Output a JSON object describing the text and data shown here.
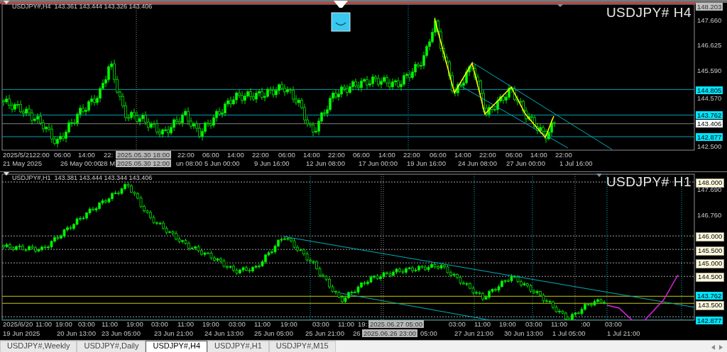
{
  "top_chart": {
    "header": "USDJPY#,H4  143.361 143.444 143.326 143.406",
    "symbol_title": "USDJPY# H4",
    "price_labels": [
      {
        "text": "148.203",
        "kind": "gray"
      },
      {
        "text": "147.660",
        "kind": "plain"
      },
      {
        "text": "146.625",
        "kind": "plain"
      },
      {
        "text": "145.590",
        "kind": "plain"
      },
      {
        "text": "144.805",
        "kind": "cyan"
      },
      {
        "text": "144.570",
        "kind": "plain"
      },
      {
        "text": "143.762",
        "kind": "cyan"
      },
      {
        "text": "143.406",
        "kind": "white"
      },
      {
        "text": "142.877",
        "kind": "cyan"
      },
      {
        "text": "142.500",
        "kind": "plain"
      }
    ],
    "time_row_1": [
      {
        "text": "2025/5/21",
        "kind": "plain"
      },
      {
        "text": "22:00",
        "kind": "plain"
      },
      {
        "text": "06:00",
        "kind": "plain"
      },
      {
        "text": "14:00",
        "kind": "plain"
      },
      {
        "text": "22:",
        "kind": "plain"
      },
      {
        "text": "2025.05.30 18:00",
        "kind": "cursor"
      },
      {
        "text": "22:00",
        "kind": "plain"
      },
      {
        "text": "06:00",
        "kind": "plain"
      },
      {
        "text": "14:00",
        "kind": "plain"
      },
      {
        "text": "22:00",
        "kind": "plain"
      },
      {
        "text": "06:00",
        "kind": "plain"
      },
      {
        "text": "14:00",
        "kind": "plain"
      },
      {
        "text": "22:00",
        "kind": "plain"
      },
      {
        "text": "06:00",
        "kind": "plain"
      },
      {
        "text": "14:00",
        "kind": "plain"
      },
      {
        "text": "22:00",
        "kind": "plain"
      },
      {
        "text": "06:00",
        "kind": "plain"
      },
      {
        "text": "14:00",
        "kind": "plain"
      },
      {
        "text": "22:00",
        "kind": "plain"
      },
      {
        "text": "06:00",
        "kind": "plain"
      },
      {
        "text": "14:00",
        "kind": "plain"
      },
      {
        "text": "22:00",
        "kind": "plain"
      }
    ],
    "time_row_2": [
      {
        "text": "21 May 2025",
        "kind": "plain"
      },
      {
        "text": "26 May 00:00",
        "kind": "plain"
      },
      {
        "text": "28 M",
        "kind": "plain"
      },
      {
        "text": "2025.05.30 12:00",
        "kind": "cursor"
      },
      {
        "text": "un 08:00",
        "kind": "plain"
      },
      {
        "text": "5 Jun 00:00",
        "kind": "plain"
      },
      {
        "text": "9 Jun 16:00",
        "kind": "plain"
      },
      {
        "text": "12 Jun 08:00",
        "kind": "plain"
      },
      {
        "text": "17 Jun 00:00",
        "kind": "plain"
      },
      {
        "text": "19 Jun 16:00",
        "kind": "plain"
      },
      {
        "text": "24 Jun 08:00",
        "kind": "plain"
      },
      {
        "text": "27 Jun 00:00",
        "kind": "plain"
      },
      {
        "text": "1 Jul 16:00",
        "kind": "plain"
      }
    ]
  },
  "bottom_chart": {
    "header": "USDJPY#,H1  143.381 143.444 143.344 143.406",
    "symbol_title": "USDJPY# H1",
    "price_labels": [
      {
        "text": "148.000",
        "kind": "cream"
      },
      {
        "text": "147.690",
        "kind": "plain"
      },
      {
        "text": "146.760",
        "kind": "plain"
      },
      {
        "text": "146.000",
        "kind": "cream"
      },
      {
        "text": "145.500",
        "kind": "cream"
      },
      {
        "text": "145.000",
        "kind": "cream"
      },
      {
        "text": "144.500",
        "kind": "cream"
      },
      {
        "text": "143.762",
        "kind": "cyan"
      },
      {
        "text": "143.500",
        "kind": "cream"
      },
      {
        "text": "142.877",
        "kind": "cyan"
      }
    ],
    "time_row_1": [
      {
        "text": "2025/6/20",
        "kind": "plain"
      },
      {
        "text": "11:00",
        "kind": "plain"
      },
      {
        "text": "19:00",
        "kind": "plain"
      },
      {
        "text": "03:00",
        "kind": "plain"
      },
      {
        "text": "11:00",
        "kind": "plain"
      },
      {
        "text": "19:00",
        "kind": "plain"
      },
      {
        "text": "03:00",
        "kind": "plain"
      },
      {
        "text": "11:00",
        "kind": "plain"
      },
      {
        "text": "19:00",
        "kind": "plain"
      },
      {
        "text": "03:00",
        "kind": "plain"
      },
      {
        "text": "11:00",
        "kind": "plain"
      },
      {
        "text": "19:00",
        "kind": "plain"
      },
      {
        "text": "03:00",
        "kind": "plain"
      },
      {
        "text": "11:00",
        "kind": "plain"
      },
      {
        "text": "19:",
        "kind": "plain"
      },
      {
        "text": "2025.06.27 05:00",
        "kind": "cursor"
      },
      {
        "text": "03:00",
        "kind": "plain"
      },
      {
        "text": "11:00",
        "kind": "plain"
      },
      {
        "text": "19:00",
        "kind": "plain"
      },
      {
        "text": "03:00",
        "kind": "plain"
      },
      {
        "text": "11:00",
        "kind": "plain"
      },
      {
        "text": ":00",
        "kind": "plain"
      },
      {
        "text": "03:00",
        "kind": "plain"
      }
    ],
    "time_row_2": [
      {
        "text": "19 Jun 2025",
        "kind": "plain"
      },
      {
        "text": "20 Jun 13:00",
        "kind": "plain"
      },
      {
        "text": "23 Jun 05:00",
        "kind": "plain"
      },
      {
        "text": "23 Jun 21:00",
        "kind": "plain"
      },
      {
        "text": "24 Jun 13:00",
        "kind": "plain"
      },
      {
        "text": "25 Jun 05:00",
        "kind": "plain"
      },
      {
        "text": "25 Jun 21:00",
        "kind": "plain"
      },
      {
        "text": "26",
        "kind": "plain"
      },
      {
        "text": "2025.06.26 23:00",
        "kind": "cursor"
      },
      {
        "text": "05:00",
        "kind": "plain"
      },
      {
        "text": "27 Jun 21:00",
        "kind": "plain"
      },
      {
        "text": "30 Jun 13:00",
        "kind": "plain"
      },
      {
        "text": "1 Jul 05:00",
        "kind": "plain"
      },
      {
        "text": "1 Jul 21:00",
        "kind": "plain"
      }
    ]
  },
  "tabs": [
    {
      "label": "USDJPY#,Weekly",
      "selected": false
    },
    {
      "label": "USDJPY#,Daily",
      "selected": false
    },
    {
      "label": "USDJPY#,H4",
      "selected": true
    },
    {
      "label": "USDJPY#,H1",
      "selected": false
    },
    {
      "label": "USDJPY#,M15",
      "selected": false
    }
  ]
}
